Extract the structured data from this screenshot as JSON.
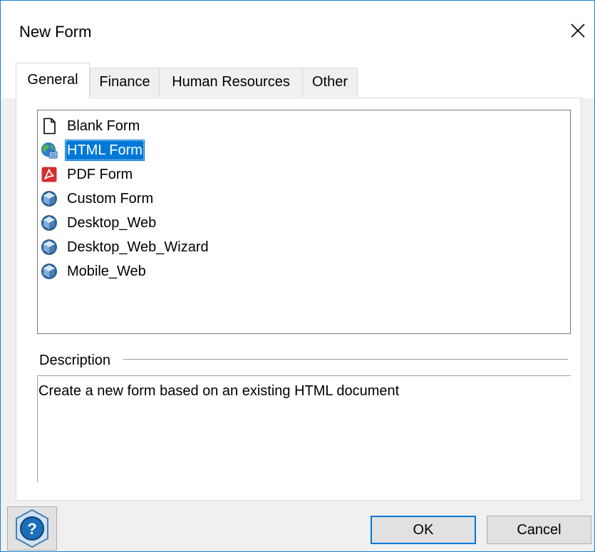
{
  "window": {
    "title": "New Form"
  },
  "tabs": [
    {
      "label": "General",
      "active": true
    },
    {
      "label": "Finance",
      "active": false
    },
    {
      "label": "Human Resources",
      "active": false
    },
    {
      "label": "Other",
      "active": false
    }
  ],
  "form_list": {
    "items": [
      {
        "label": "Blank Form",
        "icon": "blank-page-icon",
        "selected": false
      },
      {
        "label": "HTML Form",
        "icon": "globe-icon",
        "selected": true
      },
      {
        "label": "PDF Form",
        "icon": "pdf-icon",
        "selected": false
      },
      {
        "label": "Custom Form",
        "icon": "hexagon-cube-icon",
        "selected": false
      },
      {
        "label": "Desktop_Web",
        "icon": "hexagon-cube-icon",
        "selected": false
      },
      {
        "label": "Desktop_Web_Wizard",
        "icon": "hexagon-cube-icon",
        "selected": false
      },
      {
        "label": "Mobile_Web",
        "icon": "hexagon-cube-icon",
        "selected": false
      }
    ]
  },
  "description": {
    "label": "Description",
    "text": "Create a new form based on an existing HTML document"
  },
  "buttons": {
    "help_glyph": "?",
    "ok": "OK",
    "cancel": "Cancel"
  },
  "colors": {
    "selection": "#0078d7",
    "window_border": "#1883d7",
    "pdf_red": "#d32f2f",
    "hex_blue": "#4a7fb5",
    "globe_blue": "#2f7cc2",
    "globe_green": "#5bb34a"
  }
}
